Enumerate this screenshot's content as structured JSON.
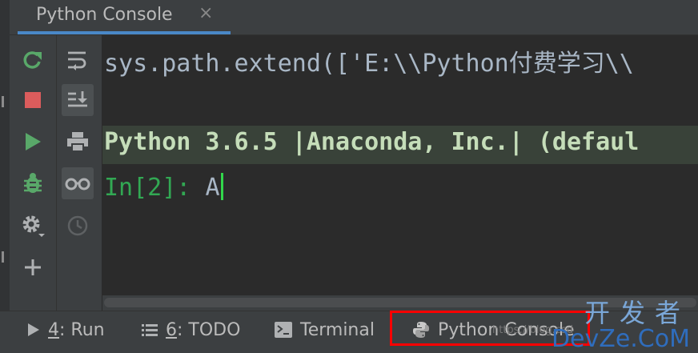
{
  "tab": {
    "title": "Python Console",
    "close": "×"
  },
  "console": {
    "line1": "sys.path.extend(['E:\\\\Python付费学习\\\\",
    "line2": "Python 3.6.5 |Anaconda, Inc.| (defaul",
    "prompt": "In[2]: ",
    "input": "A"
  },
  "left_toolbar": [
    "rerun-icon",
    "stop-icon",
    "run-icon",
    "debug-icon",
    "settings-icon",
    "add-icon"
  ],
  "right_toolbar": [
    "soft-wrap-icon",
    "scroll-to-end-icon",
    "print-icon",
    "show-variables-icon",
    "history-icon"
  ],
  "bottom_tabs": [
    {
      "key": "4",
      "label": ": Run",
      "icon": "play-icon"
    },
    {
      "key": "6",
      "label": ": TODO",
      "icon": "list-icon"
    },
    {
      "key": "",
      "label": "Terminal",
      "icon": "terminal-icon"
    },
    {
      "key": "",
      "label": "Python Console",
      "icon": "python-icon"
    }
  ],
  "watermark": {
    "cn": "开发者",
    "brand": "DevZe.CoM",
    "url": "https://blog.csd"
  },
  "colors": {
    "accent": "#4a88c7",
    "green": "#32a853",
    "red_outline": "#ff0000"
  }
}
